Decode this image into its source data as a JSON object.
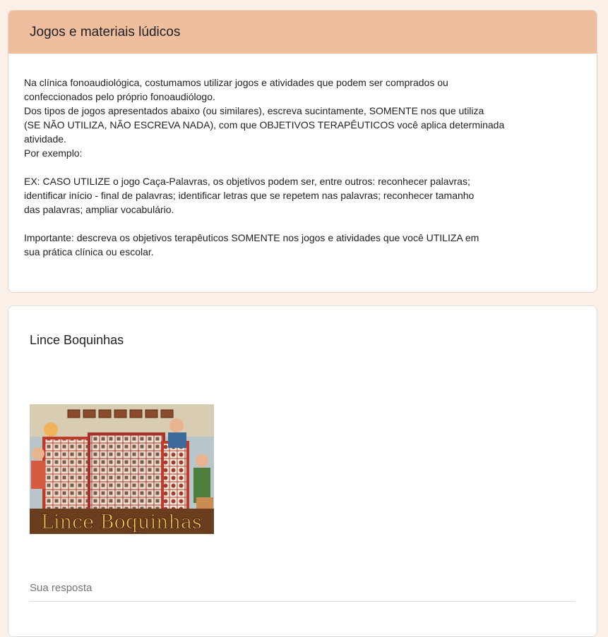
{
  "section": {
    "title": "Jogos e materiais lúdicos",
    "paragraph1_line1": "Na clínica fonoaudiológica, costumamos utilizar jogos e atividades que podem ser comprados ou",
    "paragraph1_line2": "confeccionados pelo próprio fonoaudiólogo.",
    "paragraph1_line3": "Dos tipos de jogos apresentados abaixo (ou similares), escreva sucintamente, SOMENTE nos que utiliza",
    "paragraph1_line4": "(SE NÃO UTILIZA, NÃO ESCREVA NADA), com que OBJETIVOS TERAPÊUTICOS você aplica determinada",
    "paragraph1_line5": "atividade.",
    "paragraph1_line6": "Por exemplo:",
    "example_line1": "EX:  CASO UTILIZE o jogo Caça-Palavras, os objetivos podem ser, entre outros: reconhecer palavras;",
    "example_line2": "identificar início - final de palavras; identificar letras que se repetem nas palavras; reconhecer tamanho",
    "example_line3": "das palavras; ampliar vocabulário.",
    "important_line1": "Importante: descreva os objetivos terapêuticos SOMENTE nos jogos e atividades que você UTILIZA em",
    "important_line2": "sua prática clínica ou escolar."
  },
  "question": {
    "title": "Lince Boquinhas",
    "image_caption": "Lince Boquinhas",
    "answer_placeholder": "Sua resposta"
  },
  "colors": {
    "page_background": "#fbf0e8",
    "header_accent": "#efbe9f"
  }
}
